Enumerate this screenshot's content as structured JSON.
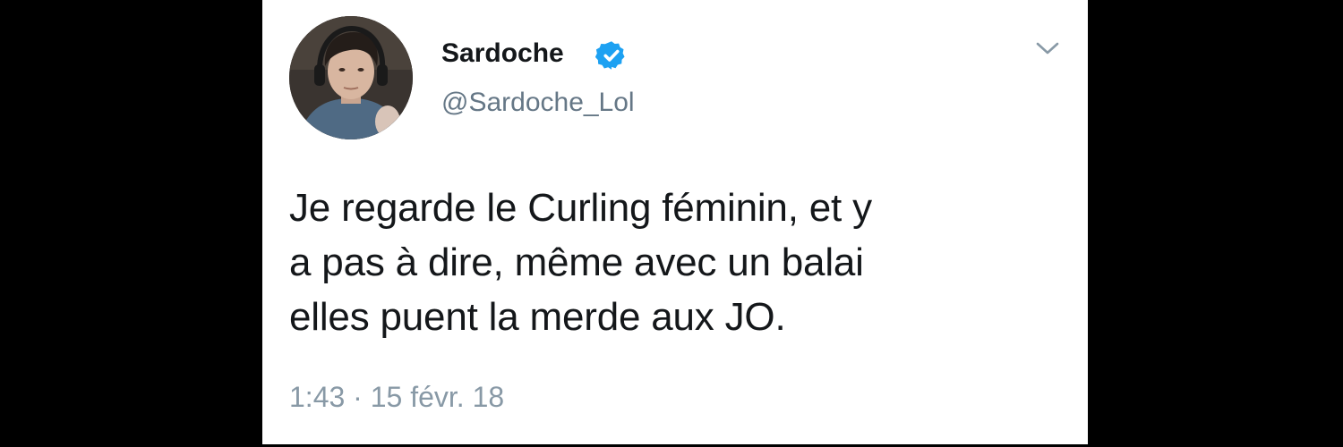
{
  "tweet": {
    "author": {
      "display_name": "Sardoche",
      "handle": "@Sardoche_Lol",
      "verified": true
    },
    "text_lines": [
      "Je regarde le Curling féminin, et y",
      "a pas à dire, même avec un balai",
      "elles puent la merde aux JO."
    ],
    "timestamp": "1:43 · 15 févr. 18"
  },
  "icons": {
    "verified": "verified-badge-icon",
    "menu": "chevron-down-icon"
  },
  "colors": {
    "background": "#000000",
    "card": "#ffffff",
    "text_primary": "#14171a",
    "text_secondary": "#657786",
    "verified_blue": "#1da1f2"
  }
}
